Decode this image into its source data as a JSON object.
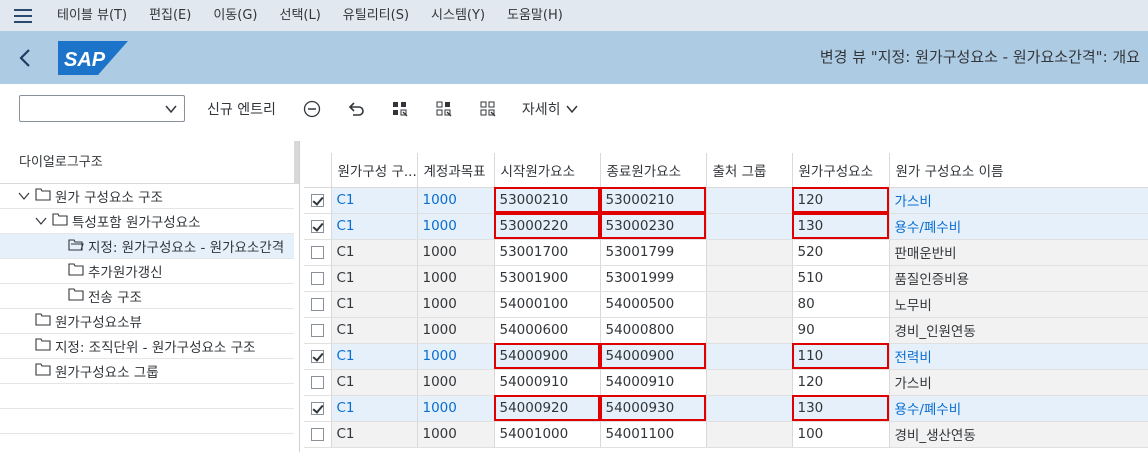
{
  "menu": [
    "테이블 뷰(T)",
    "편집(E)",
    "이동(G)",
    "선택(L)",
    "유틸리티(S)",
    "시스템(Y)",
    "도움말(H)"
  ],
  "header": {
    "title": "변경 뷰 \"지정: 원가구성요소 - 원가요소간격\": 개요",
    "logo": "SAP"
  },
  "toolbar": {
    "new_entry": "신규 엔트리",
    "details": "자세히"
  },
  "left_panel": {
    "title": "다이얼로그구조",
    "items": [
      {
        "label": "원가 구성요소 구조",
        "level": 0,
        "expanded": true
      },
      {
        "label": "특성포함 원가구성요소",
        "level": 1,
        "expanded": true
      },
      {
        "label": "지정: 원가구성요소 - 원가요소간격",
        "level": 2,
        "selected": true
      },
      {
        "label": "추가원가갱신",
        "level": 2
      },
      {
        "label": "전송 구조",
        "level": 2
      },
      {
        "label": "원가구성요소뷰",
        "level": 0
      },
      {
        "label": "지정: 조직단위 - 원가구성요소 구조",
        "level": 0
      },
      {
        "label": "원가구성요소 그룹",
        "level": 0
      }
    ]
  },
  "table": {
    "columns": [
      "원가구성 구...",
      "계정과목표",
      "시작원가요소",
      "종료원가요소",
      "출처 그룹",
      "원가구성요소",
      "원가 구성요소 이름"
    ],
    "rows": [
      {
        "checked": true,
        "cs": "C1",
        "coa": "1000",
        "from": "53000210",
        "to": "53000210",
        "origin": "",
        "comp": "120",
        "name": "가스비"
      },
      {
        "checked": true,
        "cs": "C1",
        "coa": "1000",
        "from": "53000220",
        "to": "53000230",
        "origin": "",
        "comp": "130",
        "name": "용수/폐수비"
      },
      {
        "checked": false,
        "cs": "C1",
        "coa": "1000",
        "from": "53001700",
        "to": "53001799",
        "origin": "",
        "comp": "520",
        "name": "판매운반비"
      },
      {
        "checked": false,
        "cs": "C1",
        "coa": "1000",
        "from": "53001900",
        "to": "53001999",
        "origin": "",
        "comp": "510",
        "name": "품질인증비용"
      },
      {
        "checked": false,
        "cs": "C1",
        "coa": "1000",
        "from": "54000100",
        "to": "54000500",
        "origin": "",
        "comp": "80",
        "name": "노무비"
      },
      {
        "checked": false,
        "cs": "C1",
        "coa": "1000",
        "from": "54000600",
        "to": "54000800",
        "origin": "",
        "comp": "90",
        "name": "경비_인원연동"
      },
      {
        "checked": true,
        "cs": "C1",
        "coa": "1000",
        "from": "54000900",
        "to": "54000900",
        "origin": "",
        "comp": "110",
        "name": "전력비"
      },
      {
        "checked": false,
        "cs": "C1",
        "coa": "1000",
        "from": "54000910",
        "to": "54000910",
        "origin": "",
        "comp": "120",
        "name": "가스비"
      },
      {
        "checked": true,
        "cs": "C1",
        "coa": "1000",
        "from": "54000920",
        "to": "54000930",
        "origin": "",
        "comp": "130",
        "name": "용수/폐수비"
      },
      {
        "checked": false,
        "cs": "C1",
        "coa": "1000",
        "from": "54001000",
        "to": "54001100",
        "origin": "",
        "comp": "100",
        "name": "경비_생산연동"
      }
    ]
  },
  "colors": {
    "menubar": "#e1e8f0",
    "shell": "#aecbe4",
    "selected_row": "#e5f0fa",
    "link": "#0a6ed1",
    "highlight_border": "#e00000"
  }
}
